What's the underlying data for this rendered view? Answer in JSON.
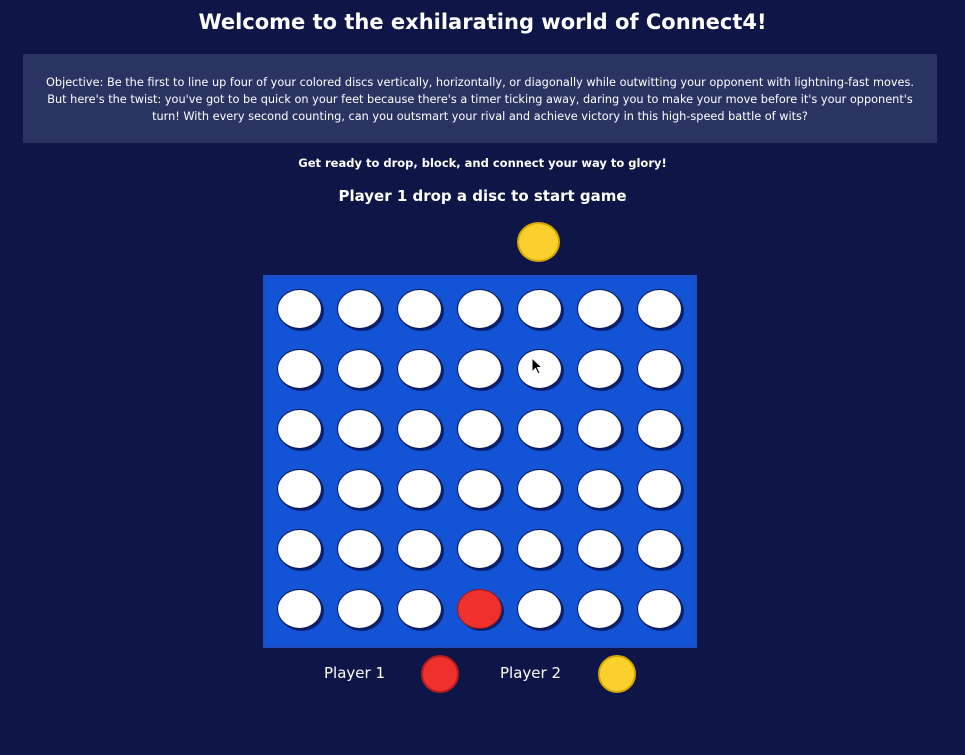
{
  "header": {
    "title": "Welcome to the exhilarating world of Connect4!"
  },
  "objective": {
    "text": "Objective: Be the first to line up four of your colored discs vertically, horizontally, or diagonally while outwitting your opponent with lightning-fast moves. But here's the twist: you've got to be quick on your feet because there's a timer ticking away, daring you to make your move before it's your opponent's turn! With every second counting, can you outsmart your rival and achieve victory in this high-speed battle of wits?"
  },
  "tagline": "Get ready to drop, block, and connect your way to glory!",
  "status": "Player 1 drop a disc to start game",
  "colors": {
    "background": "#0e1547",
    "board": "#1353d6",
    "player1": "#f0302c",
    "player2": "#fbd02d",
    "empty": "#ffffff"
  },
  "drop_preview": {
    "color": "player2",
    "column": 4
  },
  "board": {
    "rows": 6,
    "columns": 7,
    "cells": [
      [
        "empty",
        "empty",
        "empty",
        "empty",
        "empty",
        "empty",
        "empty"
      ],
      [
        "empty",
        "empty",
        "empty",
        "empty",
        "empty",
        "empty",
        "empty"
      ],
      [
        "empty",
        "empty",
        "empty",
        "empty",
        "empty",
        "empty",
        "empty"
      ],
      [
        "empty",
        "empty",
        "empty",
        "empty",
        "empty",
        "empty",
        "empty"
      ],
      [
        "empty",
        "empty",
        "empty",
        "empty",
        "empty",
        "empty",
        "empty"
      ],
      [
        "empty",
        "empty",
        "empty",
        "red",
        "empty",
        "empty",
        "empty"
      ]
    ]
  },
  "legend": {
    "player1_label": "Player 1",
    "player2_label": "Player 2"
  }
}
